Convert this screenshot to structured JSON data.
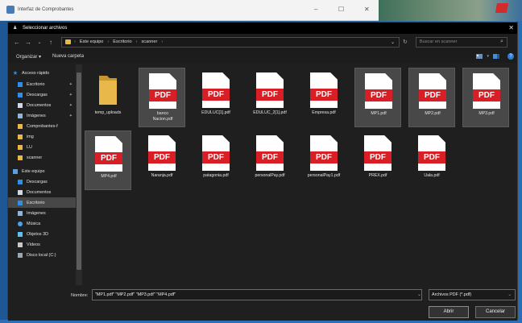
{
  "background_window": {
    "title": "Interfaz de Comprobantes",
    "controls": [
      "–",
      "☐",
      "✕"
    ]
  },
  "dialog": {
    "title": "Seleccionar archivos",
    "close": "✕",
    "nav": {
      "back": "←",
      "forward": "→",
      "dropdown": "⌄",
      "up": "↑"
    },
    "breadcrumb": [
      "Este equipo",
      "Escritorio",
      "scanner"
    ],
    "breadcrumb_sep": "›",
    "address_dropdown": "⌄",
    "refresh": "↻",
    "search_placeholder": "Buscar en scanner",
    "search_icon": "⌕",
    "toolbar": {
      "organize": "Organizar ▾",
      "new_folder": "Nueva carpeta",
      "help": "?"
    }
  },
  "sidebar": {
    "items": [
      {
        "label": "Acceso rápido",
        "icon": "star-icon",
        "color": "#2f8fe8",
        "pin": ""
      },
      {
        "label": "Escritorio",
        "icon": "desktop-icon",
        "color": "#2f8fe8",
        "pin": "✦"
      },
      {
        "label": "Descargas",
        "icon": "download-icon",
        "color": "#2f8fe8",
        "pin": "✦"
      },
      {
        "label": "Documentos",
        "icon": "document-icon",
        "color": "#cfd8e3",
        "pin": "✦"
      },
      {
        "label": "Imágenes",
        "icon": "pictures-icon",
        "color": "#8fb5d8",
        "pin": "✦"
      },
      {
        "label": "Comprobantes-f",
        "icon": "folder-icon",
        "color": "#e8b84a",
        "pin": ""
      },
      {
        "label": "img",
        "icon": "folder-icon",
        "color": "#e8b84a",
        "pin": ""
      },
      {
        "label": "LU",
        "icon": "folder-icon",
        "color": "#e8b84a",
        "pin": ""
      },
      {
        "label": "scanner",
        "icon": "folder-icon",
        "color": "#e8b84a",
        "pin": ""
      },
      {
        "label": "Este equipo",
        "icon": "computer-icon",
        "color": "#5aa0e0",
        "pin": ""
      },
      {
        "label": "Descargas",
        "icon": "download-icon",
        "color": "#2f8fe8",
        "pin": ""
      },
      {
        "label": "Documentos",
        "icon": "document-icon",
        "color": "#cfd8e3",
        "pin": ""
      },
      {
        "label": "Escritorio",
        "icon": "desktop-icon",
        "color": "#2f8fe8",
        "pin": ""
      },
      {
        "label": "Imágenes",
        "icon": "pictures-icon",
        "color": "#8fb5d8",
        "pin": ""
      },
      {
        "label": "Música",
        "icon": "music-icon",
        "color": "#4aa3ec",
        "pin": ""
      },
      {
        "label": "Objetos 3D",
        "icon": "objects-3d-icon",
        "color": "#5cc0f0",
        "pin": ""
      },
      {
        "label": "Vídeos",
        "icon": "video-icon",
        "color": "#c8c8c8",
        "pin": ""
      },
      {
        "label": "Disco local (C:)",
        "icon": "drive-icon",
        "color": "#9aa6b4",
        "pin": ""
      }
    ],
    "selected_index": 12
  },
  "files": [
    {
      "name": "temp_uploads",
      "type": "folder",
      "selected": false
    },
    {
      "name": "banco Nacion.pdf",
      "type": "pdf",
      "selected": true
    },
    {
      "name": "EDULUC[1].pdf",
      "type": "pdf",
      "selected": false
    },
    {
      "name": "EDULUC_2[1].pdf",
      "type": "pdf",
      "selected": false
    },
    {
      "name": "Empresa.pdf",
      "type": "pdf",
      "selected": false
    },
    {
      "name": "MP1.pdf",
      "type": "pdf",
      "selected": true
    },
    {
      "name": "MP2.pdf",
      "type": "pdf",
      "selected": true
    },
    {
      "name": "MP3.pdf",
      "type": "pdf",
      "selected": true
    },
    {
      "name": "MP4.pdf",
      "type": "pdf",
      "selected": true
    },
    {
      "name": "Naranja.pdf",
      "type": "pdf",
      "selected": false
    },
    {
      "name": "patagonia.pdf",
      "type": "pdf",
      "selected": false
    },
    {
      "name": "personalPay.pdf",
      "type": "pdf",
      "selected": false
    },
    {
      "name": "personalPay1.pdf",
      "type": "pdf",
      "selected": false
    },
    {
      "name": "PREX.pdf",
      "type": "pdf",
      "selected": false
    },
    {
      "name": "Uala.pdf",
      "type": "pdf",
      "selected": false
    }
  ],
  "pdf_label": "PDF",
  "footer": {
    "filename_label": "Nombre:",
    "filename_value": "\"MP1.pdf\" \"MP2.pdf\" \"MP3.pdf\" \"MP4.pdf\"",
    "filename_dropdown": "⌄",
    "filetype_value": "Archivos PDF (*.pdf)",
    "filetype_dropdown": "⌄",
    "open_label": "Abrir",
    "cancel_label": "Cancelar"
  },
  "colors": {
    "pdf_red": "#d81f26",
    "folder_yellow": "#e8b84a",
    "dialog_bg": "#1f1f1f",
    "selection_bg": "#484848"
  }
}
